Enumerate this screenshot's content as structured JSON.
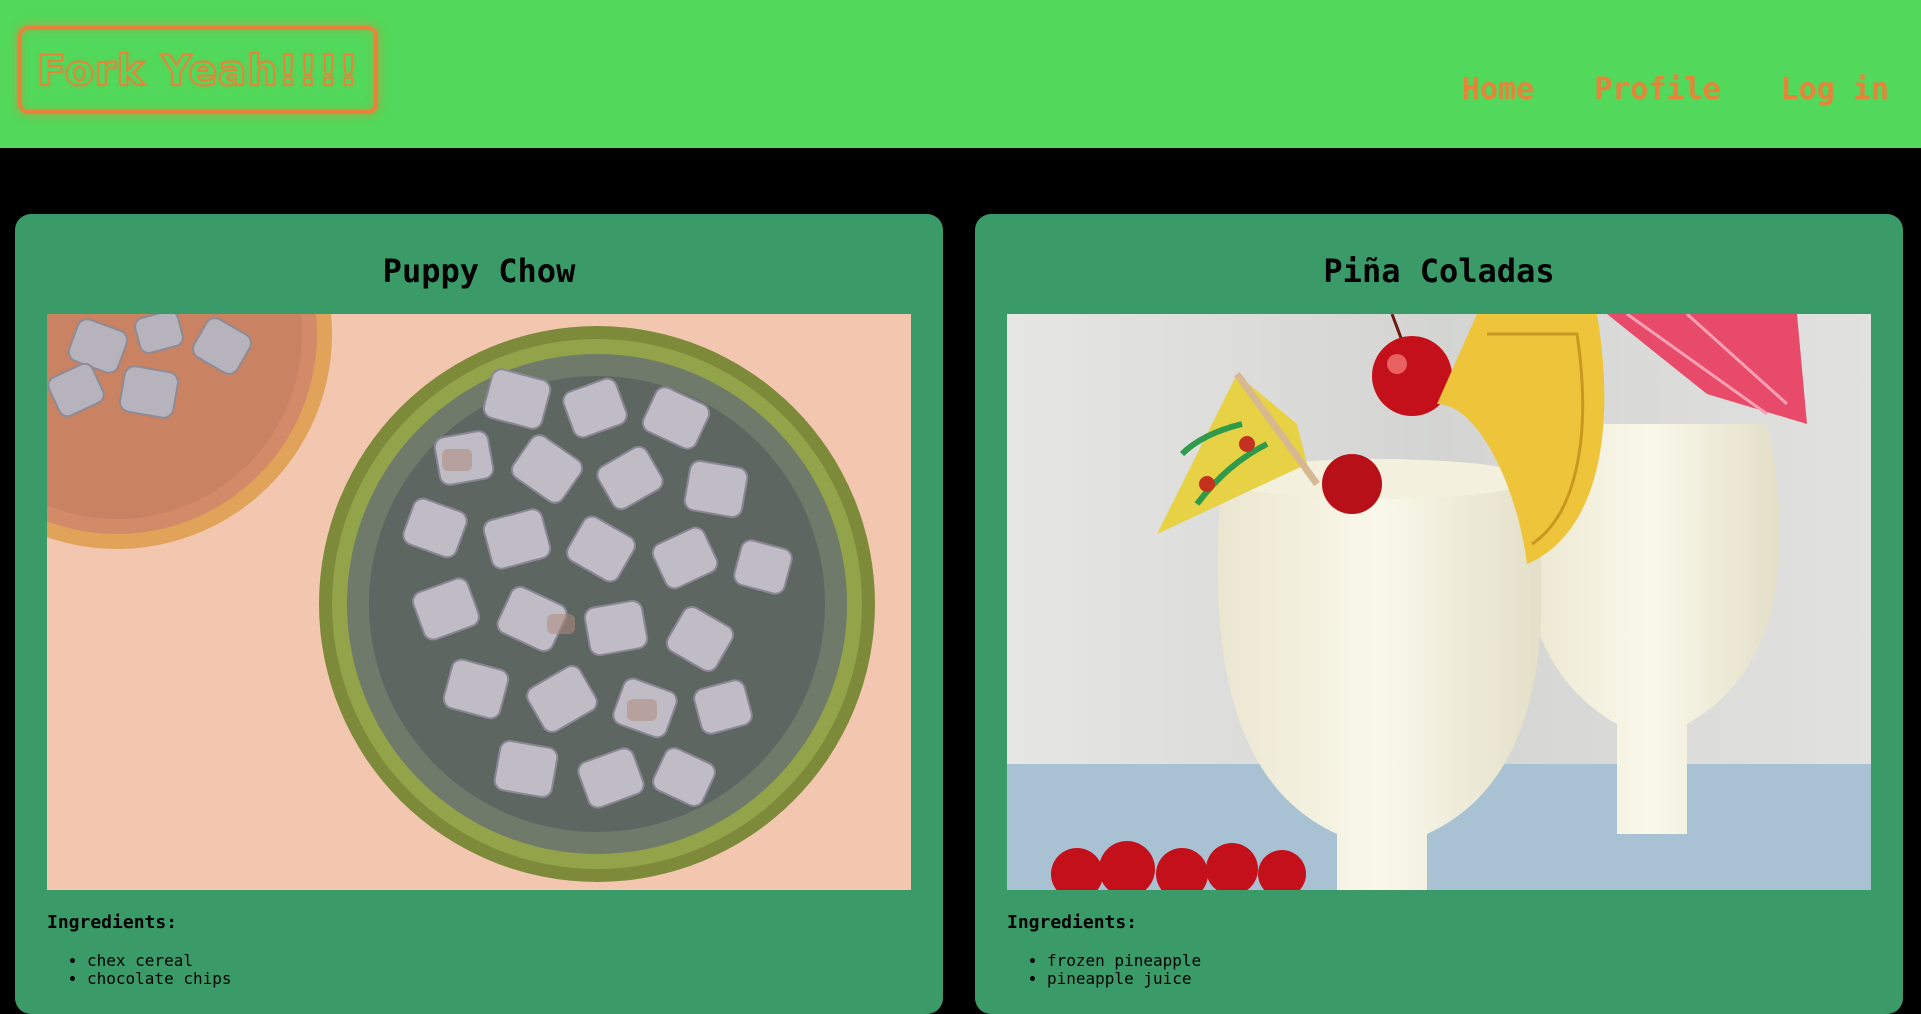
{
  "header": {
    "logo_text": "Fork Yeah!!!!",
    "nav": [
      {
        "label": "Home"
      },
      {
        "label": "Profile"
      },
      {
        "label": "Log in"
      }
    ]
  },
  "recipes": [
    {
      "title": "Puppy Chow",
      "ingredients_label": "Ingredients:",
      "ingredients": [
        "chex cereal",
        "chocolate chips"
      ]
    },
    {
      "title": "Piña Coladas",
      "ingredients_label": "Ingredients:",
      "ingredients": [
        "frozen pineapple",
        "pineapple juice"
      ]
    }
  ],
  "colors": {
    "header_bg": "#52d85a",
    "accent_orange": "#e8833a",
    "card_bg": "#3a9b69",
    "page_bg": "#000000"
  }
}
